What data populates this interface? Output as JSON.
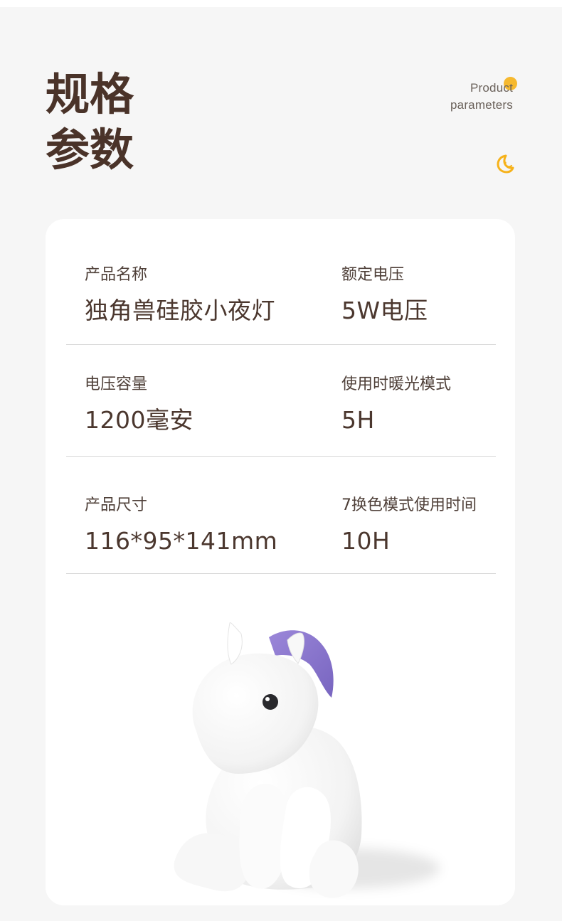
{
  "header": {
    "title_line1": "规格",
    "title_line2": "参数",
    "subtitle_line1": "Product",
    "subtitle_line2": "parameters",
    "accent_color": "#f6b21a"
  },
  "specs": {
    "name_label": "产品名称",
    "name_value": "独角兽硅胶小夜灯",
    "voltage_label": "额定电压",
    "voltage_value": "5W电压",
    "capacity_label": "电压容量",
    "capacity_value": "1200毫安",
    "warm_label": "使用时暖光模式",
    "warm_value": "5H",
    "size_label": "产品尺寸",
    "size_value": "116*95*141mm",
    "color_label": "7换色模式使用时间",
    "color_value": "10H"
  },
  "icons": {
    "top_accent": "orange-dot-icon",
    "night": "moon-icon"
  },
  "product": {
    "image": "unicorn-night-light",
    "mane_color": "#8a77c8"
  }
}
